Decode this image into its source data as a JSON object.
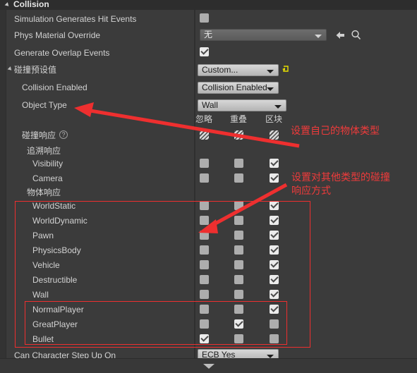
{
  "header": {
    "title": "Collision",
    "expander_icon": "triangle-down-icon"
  },
  "rows": [
    {
      "label": "Simulation Generates Hit Events",
      "indent": 1,
      "type": "checkbox",
      "checked": false
    },
    {
      "label": "Phys Material Override",
      "indent": 1,
      "type": "asset",
      "value": "无"
    },
    {
      "label": "Generate Overlap Events",
      "indent": 1,
      "type": "checkbox",
      "checked": true
    },
    {
      "label": "碰撞预设值",
      "indent": 0,
      "type": "preset",
      "value": "Custom..."
    },
    {
      "label": "Collision Enabled",
      "indent": 2,
      "type": "combo",
      "value": "Collision Enabled"
    },
    {
      "label": "Object Type",
      "indent": 2,
      "type": "combo",
      "value": "Wall"
    },
    {
      "label": "碰撞响应",
      "indent": 2,
      "type": "tristate",
      "states": [
        "mixed",
        "mixed",
        "mixed"
      ],
      "help": true
    },
    {
      "label": "追溯响应",
      "indent": 3,
      "type": "header"
    },
    {
      "label": "Visibility",
      "indent": 4,
      "type": "tristate",
      "states": [
        "off",
        "off",
        "on"
      ]
    },
    {
      "label": "Camera",
      "indent": 4,
      "type": "tristate",
      "states": [
        "off",
        "off",
        "on"
      ]
    },
    {
      "label": "物体响应",
      "indent": 3,
      "type": "header"
    },
    {
      "label": "WorldStatic",
      "indent": 4,
      "type": "tristate",
      "states": [
        "off",
        "off",
        "on"
      ]
    },
    {
      "label": "WorldDynamic",
      "indent": 4,
      "type": "tristate",
      "states": [
        "off",
        "off",
        "on"
      ]
    },
    {
      "label": "Pawn",
      "indent": 4,
      "type": "tristate",
      "states": [
        "off",
        "off",
        "on"
      ]
    },
    {
      "label": "PhysicsBody",
      "indent": 4,
      "type": "tristate",
      "states": [
        "off",
        "off",
        "on"
      ]
    },
    {
      "label": "Vehicle",
      "indent": 4,
      "type": "tristate",
      "states": [
        "off",
        "off",
        "on"
      ]
    },
    {
      "label": "Destructible",
      "indent": 4,
      "type": "tristate",
      "states": [
        "off",
        "off",
        "on"
      ]
    },
    {
      "label": "Wall",
      "indent": 4,
      "type": "tristate",
      "states": [
        "off",
        "off",
        "on"
      ]
    },
    {
      "label": "NormalPlayer",
      "indent": 4,
      "type": "tristate",
      "states": [
        "off",
        "off",
        "on"
      ]
    },
    {
      "label": "GreatPlayer",
      "indent": 4,
      "type": "tristate",
      "states": [
        "off",
        "on",
        "off"
      ]
    },
    {
      "label": "Bullet",
      "indent": 4,
      "type": "tristate",
      "states": [
        "on",
        "off",
        "off"
      ]
    },
    {
      "label": "Can Character Step Up On",
      "indent": 1,
      "type": "combo",
      "value": "ECB Yes"
    }
  ],
  "labels": {
    "sim_hit_events": "Simulation Generates Hit Events",
    "phys_material": "Phys Material Override",
    "generate_overlap": "Generate Overlap Events",
    "collision_preset": "碰撞预设值",
    "collision_enabled": "Collision Enabled",
    "object_type": "Object Type",
    "collision_response": "碰撞响应",
    "trace_response": "追溯响应",
    "visibility": "Visibility",
    "camera": "Camera",
    "object_response": "物体响应",
    "world_static": "WorldStatic",
    "world_dynamic": "WorldDynamic",
    "pawn": "Pawn",
    "physics_body": "PhysicsBody",
    "vehicle": "Vehicle",
    "destructible": "Destructible",
    "wall": "Wall",
    "normal_player": "NormalPlayer",
    "great_player": "GreatPlayer",
    "bullet": "Bullet",
    "can_step_up": "Can Character Step Up On"
  },
  "values": {
    "phys_material_override": "无",
    "collision_preset": "Custom...",
    "collision_enabled": "Collision Enabled",
    "object_type": "Wall",
    "can_character_step_up_on": "ECB Yes"
  },
  "columns": {
    "ignore": "忽略",
    "overlap": "重叠",
    "block": "区块"
  },
  "help_glyph": "?",
  "annotations": [
    {
      "text": "设置自己的物体类型"
    },
    {
      "text": "设置对其他类型的碰撞"
    },
    {
      "text": "响应方式"
    }
  ],
  "colors": {
    "annotation": "#ef3b3b",
    "panel_bg": "#3b3b3b",
    "header_bg": "#2d2d2d",
    "text": "#d2d2d2",
    "reset_icon": "#e8e000"
  },
  "icons": {
    "browse": "back-arrow-icon",
    "find": "magnifier-icon",
    "reset": "reset-arrow-icon",
    "expand_bottom": "chevron-down-icon"
  }
}
